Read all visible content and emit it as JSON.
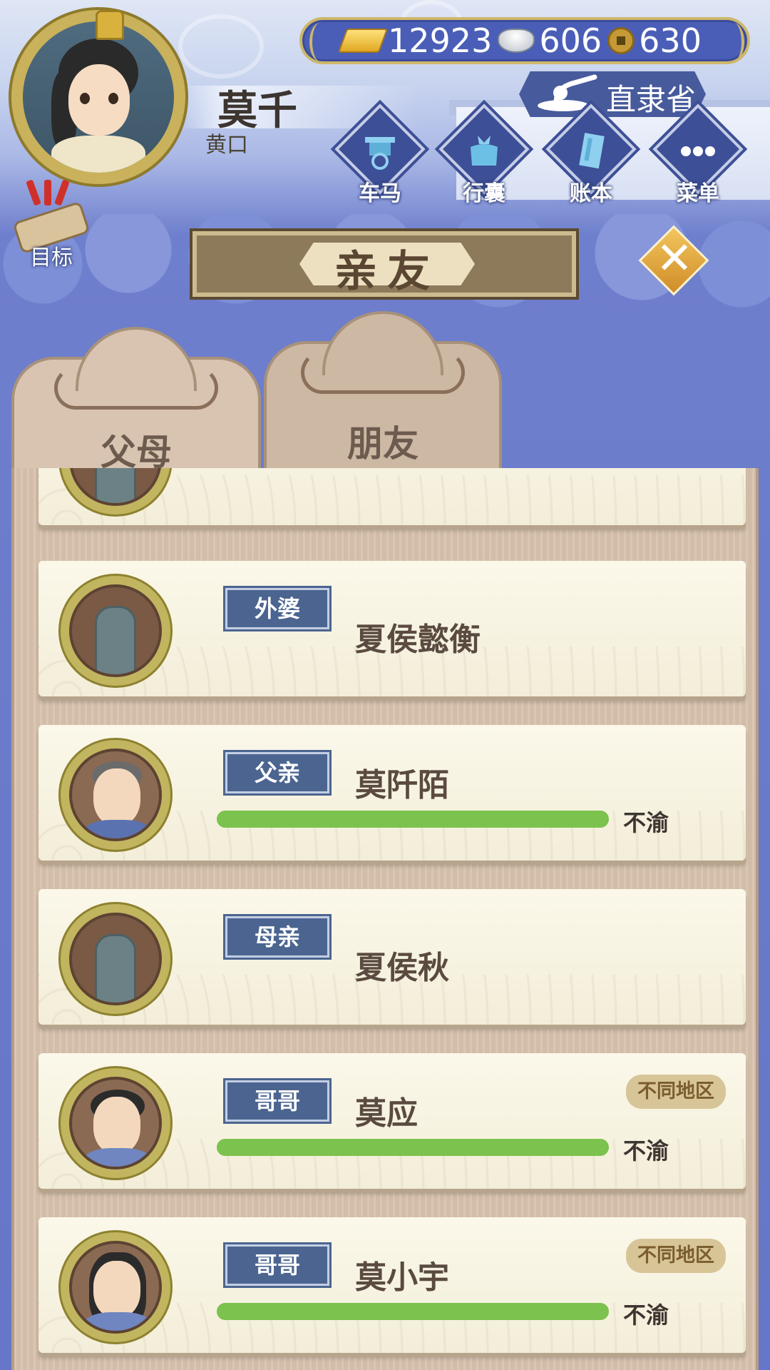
{
  "player": {
    "name": "莫千",
    "age": "黄口"
  },
  "currency": {
    "gold": "12923",
    "silver": "606",
    "copper": "630"
  },
  "location": "直隶省",
  "nav": {
    "carriage": "车马",
    "bag": "行囊",
    "ledger": "账本",
    "menu": "菜单",
    "goal": "目标"
  },
  "panel": {
    "title": "亲友",
    "close_symbol": "✕"
  },
  "tabs": [
    {
      "label": "父母",
      "active": true
    },
    {
      "label": "朋友",
      "active": false
    }
  ],
  "relatives": [
    {
      "relation": "外婆",
      "name": "夏侯懿衡",
      "deceased": true
    },
    {
      "relation": "父亲",
      "name": "莫阡陌",
      "deceased": false,
      "mood": "不渝",
      "mood_level": 1.0
    },
    {
      "relation": "母亲",
      "name": "夏侯秋",
      "deceased": true
    },
    {
      "relation": "哥哥",
      "name": "莫应",
      "deceased": false,
      "mood": "不渝",
      "mood_level": 1.0,
      "badge": "不同地区"
    },
    {
      "relation": "哥哥",
      "name": "莫小宇",
      "deceased": false,
      "mood": "不渝",
      "mood_level": 1.0,
      "badge": "不同地区"
    }
  ],
  "colors": {
    "mood_bar": "#7cc24e",
    "tag_bg": "#4b6590",
    "panel_bg": "#d9c3ae"
  }
}
